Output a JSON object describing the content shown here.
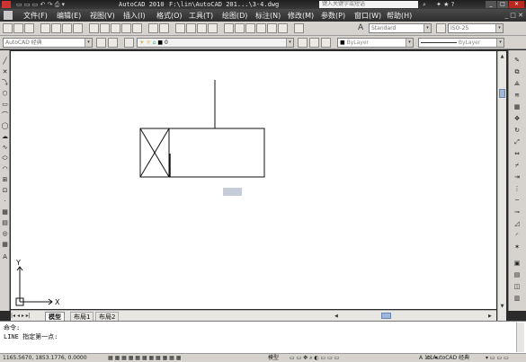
{
  "titlebar": {
    "app_title": "AutoCAD 2010",
    "file_path": "F:\\lin\\AutoCAD 201...\\3-4.dwg",
    "search_placeholder": "键入关键字或短语"
  },
  "menubar": {
    "items": [
      "文件(F)",
      "编辑(E)",
      "视图(V)",
      "插入(I)",
      "格式(O)",
      "工具(T)",
      "绘图(D)",
      "标注(N)",
      "修改(M)",
      "参数(P)",
      "窗口(W)",
      "帮助(H)"
    ]
  },
  "toolbar": {
    "workspace": "AutoCAD 经典",
    "text_style": "Standard",
    "dim_style": "ISO-25",
    "layer_value": "0",
    "color_value": "ByLayer",
    "linetype_value": "ByLayer"
  },
  "drawing": {
    "ucs_x": "X",
    "ucs_y": "Y"
  },
  "tabs": [
    "模型",
    "布局1",
    "布局2"
  ],
  "command": {
    "line1": "命令:",
    "line2": "LINE 指定第一点:"
  },
  "status": {
    "coords": "1165.5670, 1853.1776, 0.0000",
    "model_label": "模型",
    "workspace_label": "AutoCAD 经典"
  },
  "colors": {
    "titlebar": "#2b2b2b",
    "canvas": "#ffffff",
    "toolbar": "#d6d3ce",
    "highlight": "#c7ccda"
  }
}
